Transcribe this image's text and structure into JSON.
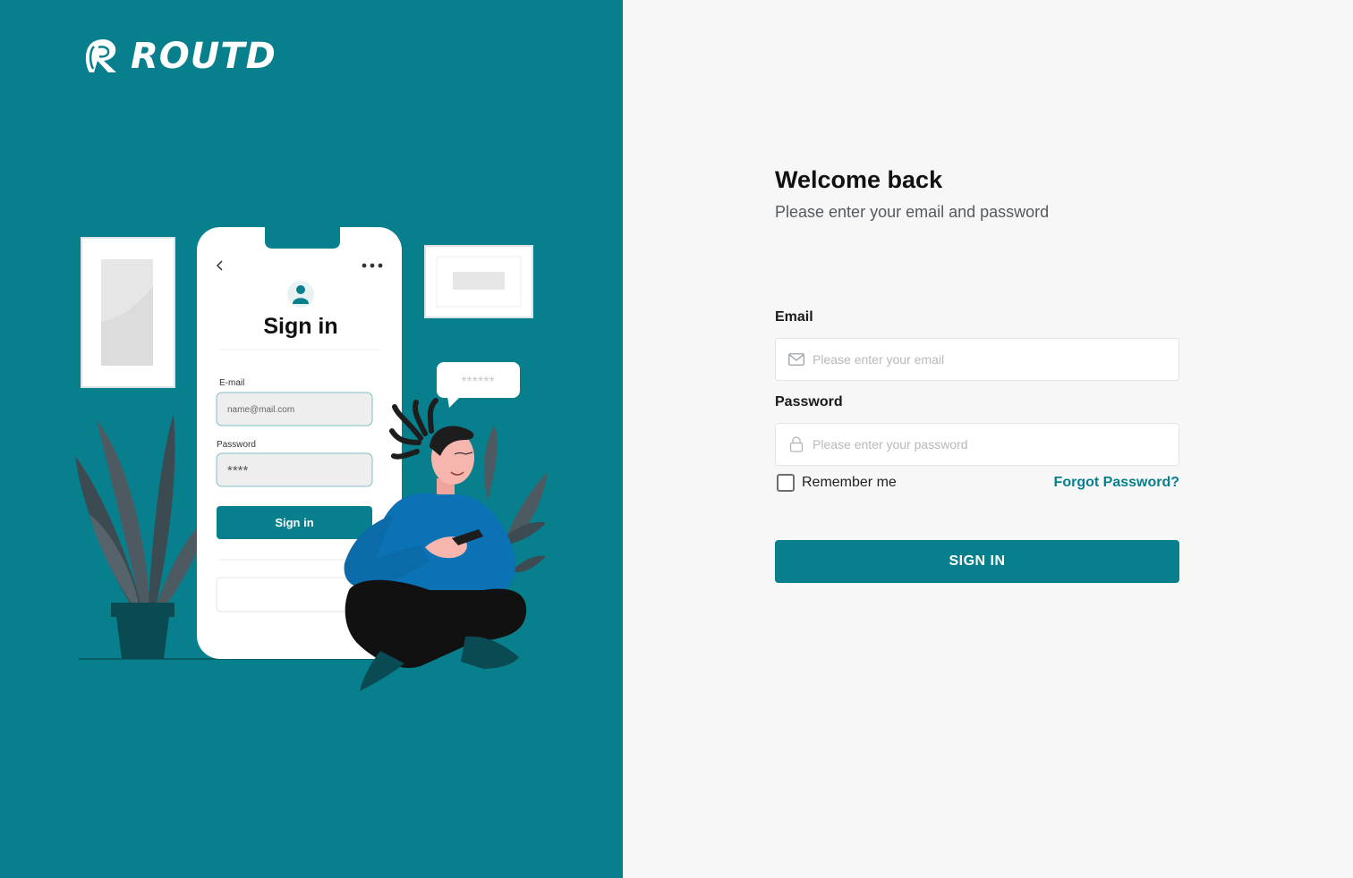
{
  "brand": {
    "name": "ROUTD",
    "primary_color": "#087f8c",
    "logo_icon": "road-r-logo-icon"
  },
  "illustration": {
    "phone": {
      "title": "Sign in",
      "email_label": "E-mail",
      "email_value": "name@mail.com",
      "password_label": "Password",
      "password_value": "****",
      "button_label": "Sign in"
    },
    "speech_bubble": "******"
  },
  "login": {
    "title": "Welcome back",
    "subtitle": "Please enter your email and password",
    "email": {
      "label": "Email",
      "placeholder": "Please enter your email",
      "value": "",
      "icon": "envelope-icon"
    },
    "password": {
      "label": "Password",
      "placeholder": "Please enter your password",
      "value": "",
      "icon": "lock-icon"
    },
    "remember_label": "Remember me",
    "remember_checked": false,
    "forgot_label": "Forgot Password?",
    "submit_label": "SIGN IN"
  }
}
